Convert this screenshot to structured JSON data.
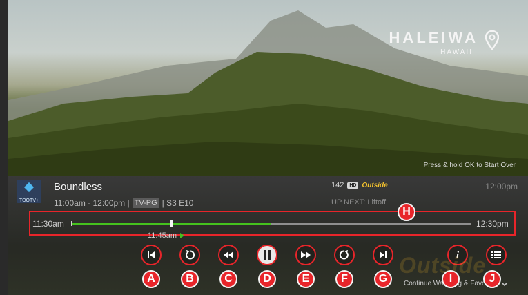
{
  "location": {
    "city": "HALEIWA",
    "state": "HAWAII",
    "icon": "map-pin-icon"
  },
  "hint": "Press & hold OK to Start Over",
  "channel_logo": {
    "text": "TOOTV+"
  },
  "program": {
    "title": "Boundless",
    "time_range": "11:00am - 12:00pm |",
    "rating": "TV-PG",
    "episode": "| S3 E10"
  },
  "channel": {
    "number": "142",
    "hd": "HD",
    "network": "Outside"
  },
  "up_next": "UP NEXT: Liftoff",
  "clock": "12:00pm",
  "timeline": {
    "start_label": "11:30am",
    "end_label": "12:30pm",
    "marker_label": "11:45am",
    "progress": 0.5,
    "playhead": 0.25,
    "badge": "H"
  },
  "controls": [
    {
      "name": "skip-previous-button",
      "icon": "skip-previous-icon",
      "badge": "A"
    },
    {
      "name": "replay-button",
      "icon": "replay-icon",
      "badge": "B"
    },
    {
      "name": "rewind-button",
      "icon": "rewind-icon",
      "badge": "C"
    },
    {
      "name": "pause-button",
      "icon": "pause-icon",
      "badge": "D"
    },
    {
      "name": "fast-forward-button",
      "icon": "fast-forward-icon",
      "badge": "E"
    },
    {
      "name": "skip-forward-button",
      "icon": "skip-forward-icon",
      "badge": "F"
    },
    {
      "name": "skip-next-button",
      "icon": "skip-next-icon",
      "badge": "G"
    },
    {
      "name": "info-button",
      "icon": "info-icon",
      "badge": "I"
    },
    {
      "name": "list-button",
      "icon": "list-icon",
      "badge": "J"
    }
  ],
  "watermark": "Outside",
  "continue_label": "Continue Watching & Favorites",
  "colors": {
    "accent": "#e8252a",
    "progress": "#45c21e",
    "network": "#f2c12e"
  }
}
